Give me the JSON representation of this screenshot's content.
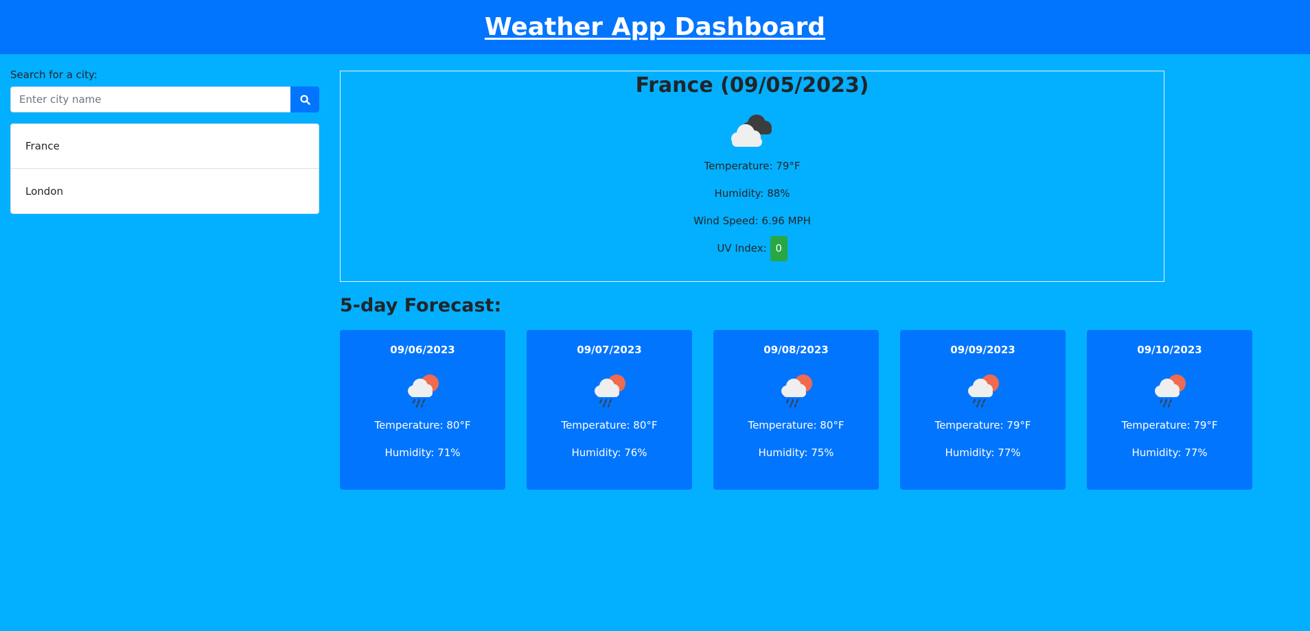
{
  "header": {
    "title": "Weather App Dashboard"
  },
  "search": {
    "label": "Search for a city:",
    "placeholder": "Enter city name",
    "button_icon": "search-icon"
  },
  "history": [
    "France",
    "London"
  ],
  "current": {
    "title": "France (09/05/2023)",
    "icon": "broken-clouds-icon",
    "temperature": "Temperature: 79°F",
    "humidity": "Humidity: 88%",
    "wind": "Wind Speed: 6.96 MPH",
    "uv_label": "UV Index:",
    "uv_value": "0",
    "uv_color": "#28a745"
  },
  "forecast": {
    "title": "5-day Forecast:",
    "days": [
      {
        "date": "09/06/2023",
        "icon": "light-rain-icon",
        "temp": "Temperature: 80°F",
        "humidity": "Humidity: 71%"
      },
      {
        "date": "09/07/2023",
        "icon": "light-rain-icon",
        "temp": "Temperature: 80°F",
        "humidity": "Humidity: 76%"
      },
      {
        "date": "09/08/2023",
        "icon": "light-rain-icon",
        "temp": "Temperature: 80°F",
        "humidity": "Humidity: 75%"
      },
      {
        "date": "09/09/2023",
        "icon": "light-rain-icon",
        "temp": "Temperature: 79°F",
        "humidity": "Humidity: 77%"
      },
      {
        "date": "09/10/2023",
        "icon": "light-rain-icon",
        "temp": "Temperature: 79°F",
        "humidity": "Humidity: 77%"
      }
    ]
  },
  "colors": {
    "page_bg": "#03b0ff",
    "accent": "#0275ff",
    "uv_badge": "#28a745"
  }
}
